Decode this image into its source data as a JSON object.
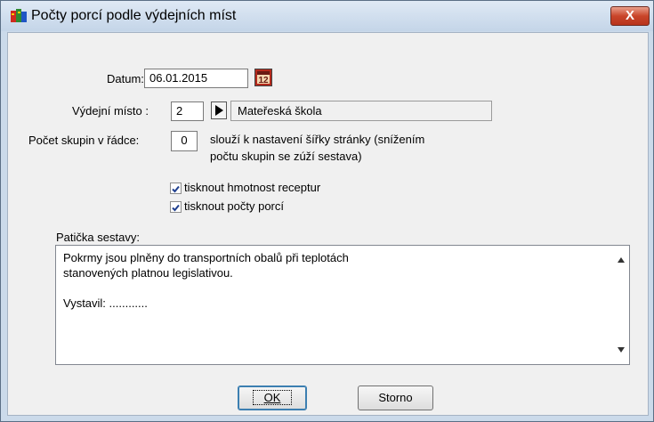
{
  "window": {
    "title": "Počty porcí podle výdejních míst",
    "close_label": "X"
  },
  "form": {
    "datum_label": "Datum:",
    "datum_value": "06.01.2015",
    "misto_label": "Výdejní místo :",
    "misto_value": "2",
    "misto_name": "Mateřeská škola",
    "skupin_label": "Počet skupin v řádce:",
    "skupin_value": "0",
    "skupin_hint_line1": "slouží k nastavení šířky stránky (snížením",
    "skupin_hint_line2": "počtu skupin se zúží sestava)",
    "check1_label": "tisknout hmotnost receptur",
    "check1_checked": true,
    "check2_label": "tisknout počty porcí",
    "check2_checked": true,
    "paticka_label": "Patička sestavy:",
    "paticka_lines": [
      "Pokrmy jsou plněny do transportních obalů při teplotách",
      "stanovených platnou legislativou.",
      "",
      "Vystavil: ............"
    ]
  },
  "buttons": {
    "ok_label": "OK",
    "storno_label": "Storno"
  }
}
